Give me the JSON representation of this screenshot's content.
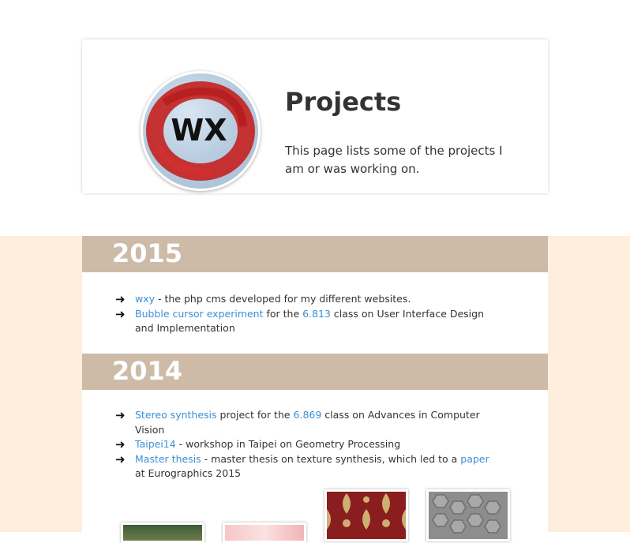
{
  "header": {
    "title": "Projects",
    "intro": "This page lists some of the projects I am or was working on.",
    "logo_text": "WX"
  },
  "sections": [
    {
      "year": "2015",
      "items": [
        {
          "link": "wxy",
          "after": " - the php cms developed for my different websites."
        },
        {
          "link": "Bubble cursor experiment",
          "mid": " for the ",
          "link2": "6.813",
          "after": " class on User Interface Design and Implementation"
        }
      ]
    },
    {
      "year": "2014",
      "items": [
        {
          "link": "Stereo synthesis",
          "mid": " project for the ",
          "link2": "6.869",
          "after": " class on Advances in Computer Vision"
        },
        {
          "link": "Taipei14",
          "after": " - workshop in Taipei on Geometry Processing"
        },
        {
          "link": "Master thesis",
          "mid": " - master thesis on texture synthesis, which led to a ",
          "link2": "paper",
          "after": " at Eurographics 2015"
        }
      ]
    }
  ],
  "thumbnails": [
    "landscape-thumbnail",
    "pink-texture-thumbnail",
    "damask-texture-thumbnail",
    "hexagon-stone-texture-thumbnail"
  ],
  "colors": {
    "accent": "#3a8fd6",
    "band": "#cdbba8",
    "peach": "#fdeedd",
    "logo_red": "#c42424"
  }
}
